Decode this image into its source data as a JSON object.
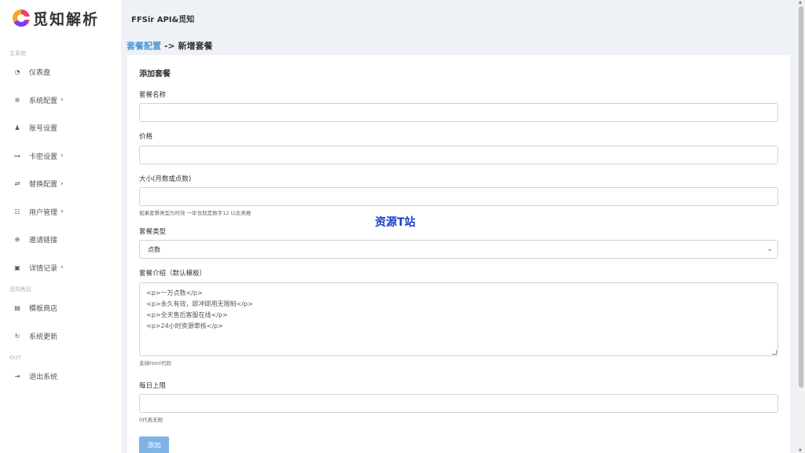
{
  "logo": {
    "text": "觅知解析"
  },
  "sidebar": {
    "sections": [
      {
        "label": "主系统",
        "items": [
          {
            "icon": "◔",
            "label": "仪表盘",
            "arrow": ""
          },
          {
            "icon": "✲",
            "label": "系统配置",
            "arrow": "›"
          },
          {
            "icon": "♟",
            "label": "账号设置",
            "arrow": ""
          },
          {
            "icon": "⊶",
            "label": "卡密设置",
            "arrow": "›"
          },
          {
            "icon": "⇄",
            "label": "替换配置",
            "arrow": "›"
          },
          {
            "icon": "☷",
            "label": "用户管理",
            "arrow": "›"
          },
          {
            "icon": "⊕",
            "label": "邀请链接",
            "arrow": ""
          },
          {
            "icon": "▣",
            "label": "详情记录",
            "arrow": "›"
          }
        ]
      },
      {
        "label": "觅知售后",
        "items": [
          {
            "icon": "▤",
            "label": "模板商店",
            "arrow": ""
          },
          {
            "icon": "↻",
            "label": "系统更新",
            "arrow": ""
          }
        ]
      },
      {
        "label": "OUT",
        "items": [
          {
            "icon": "⇥",
            "label": "退出系统",
            "arrow": ""
          }
        ]
      }
    ]
  },
  "header": {
    "title": "FFSir API&觅知"
  },
  "breadcrumb": {
    "link": "套餐配置",
    "separator": " -> ",
    "current": "新增套餐"
  },
  "form": {
    "title": "添加套餐",
    "name_label": "套餐名称",
    "name_value": "",
    "price_label": "价格",
    "price_value": "",
    "size_label": "大小(月数或点数)",
    "size_value": "",
    "size_help": "如果套餐类型为时效 一年也就是数字12 以此类推",
    "type_label": "套餐类型",
    "type_selected": "点数",
    "intro_label": "套餐介绍（默认模板）",
    "intro_value": "<p>一万点数</p>\n<p>永久有效，即冲即用无限制</p>\n<p>全天售后客服在线</p>\n<p>24小时资源审核</p>",
    "intro_help": "支持html代码",
    "limit_label": "每日上限",
    "limit_value": "",
    "limit_help": "0代表无限",
    "submit_label": "添加"
  },
  "watermark": "资源T站"
}
